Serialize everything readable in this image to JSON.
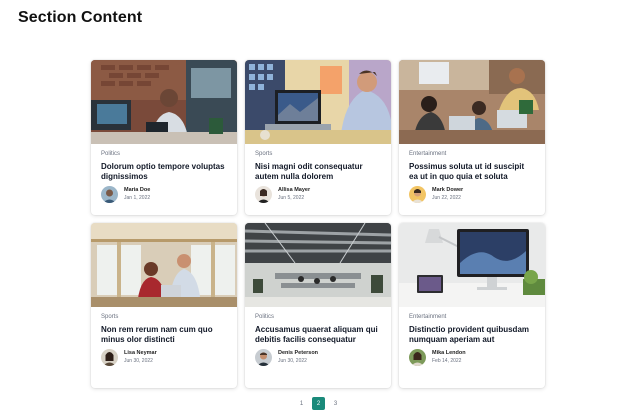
{
  "section": {
    "title": "Section Content"
  },
  "cards": [
    {
      "category": "Politics",
      "title": "Dolorum optio tempore voluptas dignissimos",
      "author": "Maria Doe",
      "date": "Jan 1, 2022"
    },
    {
      "category": "Sports",
      "title": "Nisi magni odit consequatur autem nulla dolorem",
      "author": "Allisa Mayer",
      "date": "Jun 5, 2022"
    },
    {
      "category": "Entertainment",
      "title": "Possimus soluta ut id suscipit ea ut in quo quia et soluta",
      "author": "Mark Dower",
      "date": "Jun 22, 2022"
    },
    {
      "category": "Sports",
      "title": "Non rem rerum nam cum quo minus olor distincti",
      "author": "Lisa Neymar",
      "date": "Jun 30, 2022"
    },
    {
      "category": "Politics",
      "title": "Accusamus quaerat aliquam qui debitis facilis consequatur",
      "author": "Denis Peterson",
      "date": "Jun 30, 2022"
    },
    {
      "category": "Entertainment",
      "title": "Distinctio provident quibusdam numquam aperiam aut",
      "author": "Mika Lendon",
      "date": "Feb 14, 2022"
    }
  ],
  "pagination": {
    "pages": [
      "1",
      "2",
      "3"
    ],
    "active": "2"
  },
  "colors": {
    "accent": "#1a8a7a"
  }
}
